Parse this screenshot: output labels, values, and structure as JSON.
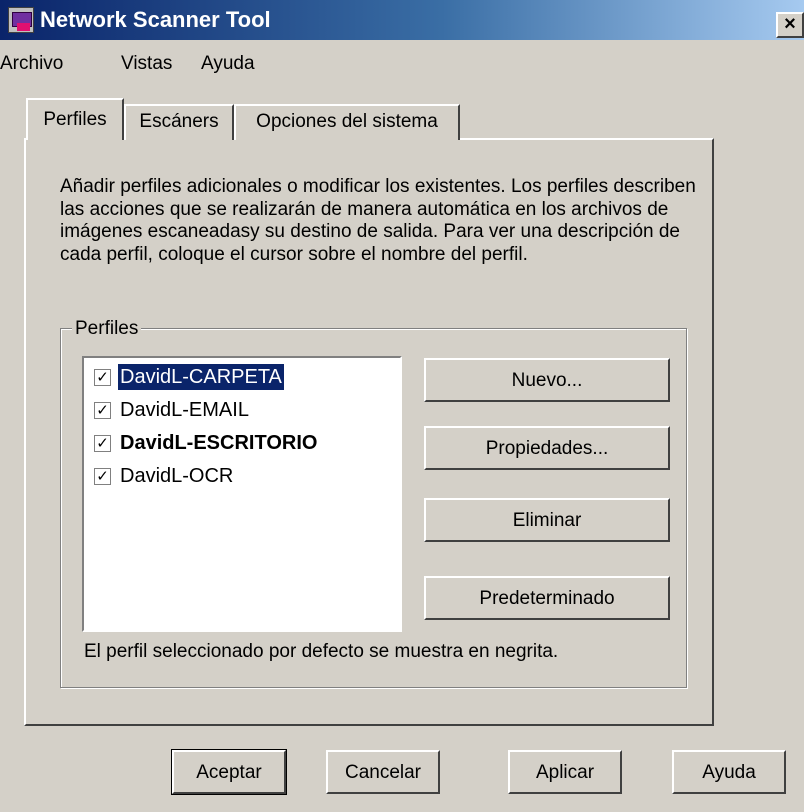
{
  "window": {
    "title": "Network Scanner Tool",
    "close_label": "×"
  },
  "menu": {
    "items": [
      "Archivo",
      "Vistas",
      "Ayuda"
    ]
  },
  "tabs": [
    {
      "label": "Perfiles",
      "active": true
    },
    {
      "label": "Escáners",
      "active": false
    },
    {
      "label": "Opciones del sistema",
      "active": false
    }
  ],
  "description": "Añadir perfiles adicionales o modificar los  existentes. Los perfiles describen las acciones  que se realizarán de manera automática en los archivos de imágenes escaneadasy su destino de salida. Para ver una descripción de cada perfil, coloque el cursor sobre el nombre del perfil.",
  "profiles_group": {
    "label": "Perfiles",
    "items": [
      {
        "name": "DavidL-CARPETA",
        "checked": true,
        "selected": true,
        "default": false
      },
      {
        "name": "DavidL-EMAIL",
        "checked": true,
        "selected": false,
        "default": false
      },
      {
        "name": "DavidL-ESCRITORIO",
        "checked": true,
        "selected": false,
        "default": true
      },
      {
        "name": "DavidL-OCR",
        "checked": true,
        "selected": false,
        "default": false
      }
    ],
    "check_mark": "✓",
    "buttons": {
      "nuevo": "Nuevo...",
      "propiedades": "Propiedades...",
      "eliminar": "Eliminar",
      "predeterminado": "Predeterminado"
    },
    "footnote": "El perfil seleccionado por defecto se muestra en  negrita."
  },
  "dialog_buttons": {
    "aceptar": "Aceptar",
    "cancelar": "Cancelar",
    "aplicar": "Aplicar",
    "ayuda": "Ayuda"
  }
}
